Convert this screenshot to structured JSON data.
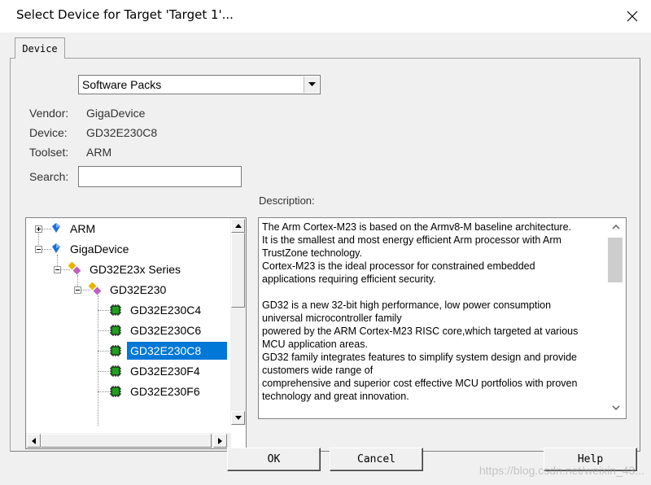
{
  "window": {
    "title": "Select Device for Target 'Target 1'..."
  },
  "tabs": [
    {
      "label": "Device",
      "active": true
    }
  ],
  "source_select": {
    "value": "Software Packs"
  },
  "device_info": {
    "vendor_label": "Vendor:",
    "vendor_value": "GigaDevice",
    "device_label": "Device:",
    "device_value": "GD32E230C8",
    "toolset_label": "Toolset:",
    "toolset_value": "ARM",
    "search_label": "Search:",
    "search_value": ""
  },
  "description": {
    "label": "Description:",
    "text": "The Arm Cortex-M23 is based on the Armv8-M baseline architecture.\nIt is the smallest and most energy efficient Arm processor with Arm\nTrustZone technology.\nCortex-M23 is the ideal processor for constrained embedded\napplications requiring efficient security.\n\nGD32 is a new 32-bit high performance, low power consumption\nuniversal microcontroller family\npowered by the ARM Cortex-M23 RISC core,which targeted at various\nMCU application areas.\nGD32 family integrates features to simplify system design and provide\ncustomers wide range of\ncomprehensive and superior cost effective MCU portfolios with proven\ntechnology and great innovation."
  },
  "tree": {
    "items": [
      {
        "label": "ARM",
        "level": 0,
        "expanded": false,
        "icon": "vendor-icon"
      },
      {
        "label": "GigaDevice",
        "level": 0,
        "expanded": true,
        "icon": "vendor-icon"
      },
      {
        "label": "GD32E23x Series",
        "level": 1,
        "expanded": true,
        "icon": "family-icon"
      },
      {
        "label": "GD32E230",
        "level": 2,
        "expanded": true,
        "icon": "family-icon"
      },
      {
        "label": "GD32E230C4",
        "level": 3,
        "icon": "chip-icon"
      },
      {
        "label": "GD32E230C6",
        "level": 3,
        "icon": "chip-icon"
      },
      {
        "label": "GD32E230C8",
        "level": 3,
        "icon": "chip-icon",
        "selected": true
      },
      {
        "label": "GD32E230F4",
        "level": 3,
        "icon": "chip-icon"
      },
      {
        "label": "GD32E230F6",
        "level": 3,
        "icon": "chip-icon"
      }
    ]
  },
  "buttons": {
    "ok": "OK",
    "cancel": "Cancel",
    "help": "Help"
  },
  "watermark": "https://blog.csdn.net/weixin_43...",
  "colors": {
    "selection": "#0078d7",
    "dialog_bg": "#f0f0f0"
  }
}
